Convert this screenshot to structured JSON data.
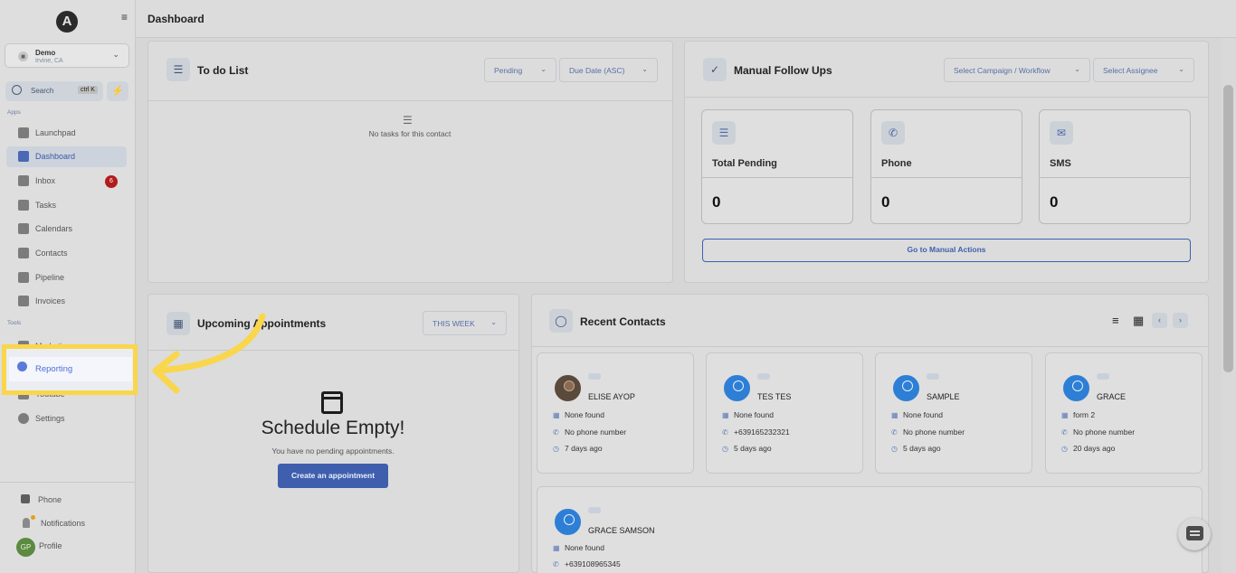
{
  "sidebar": {
    "logo": "A",
    "location": {
      "name": "Demo",
      "sub": "Irvine, CA"
    },
    "search": {
      "label": "Search",
      "shortcut": "ctrl K"
    },
    "sections": {
      "apps": "Apps",
      "tools": "Tools"
    },
    "items": [
      {
        "label": "Launchpad",
        "icon": "rocket-icon"
      },
      {
        "label": "Dashboard",
        "icon": "grid-icon",
        "active": true
      },
      {
        "label": "Inbox",
        "icon": "inbox-icon",
        "badge": "6"
      },
      {
        "label": "Tasks",
        "icon": "tasks-icon"
      },
      {
        "label": "Calendars",
        "icon": "calendar-icon"
      },
      {
        "label": "Contacts",
        "icon": "user-icon"
      },
      {
        "label": "Pipeline",
        "icon": "funnel-icon"
      },
      {
        "label": "Invoices",
        "icon": "invoice-icon"
      }
    ],
    "tools": [
      {
        "label": "Marketing",
        "icon": "megaphone-icon"
      },
      {
        "label": "Reporting",
        "icon": "pie-chart-icon",
        "highlighted": true
      },
      {
        "label": "Youtube",
        "icon": "youtube-icon"
      },
      {
        "label": "Settings",
        "icon": "gear-icon"
      }
    ],
    "footer": {
      "phone": "Phone",
      "notifications": "Notifications",
      "profile": "Profile",
      "initials": "GP"
    }
  },
  "header": {
    "title": "Dashboard"
  },
  "todo": {
    "title": "To do List",
    "filter_status": "Pending",
    "filter_sort": "Due Date (ASC)",
    "empty_text": "No tasks for this contact"
  },
  "followups": {
    "title": "Manual Follow Ups",
    "campaign_placeholder": "Select Campaign / Workflow",
    "assignee_placeholder": "Select Assignee",
    "stats": [
      {
        "label": "Total Pending",
        "value": "0",
        "icon": "checklist-icon"
      },
      {
        "label": "Phone",
        "value": "0",
        "icon": "phone-icon"
      },
      {
        "label": "SMS",
        "value": "0",
        "icon": "message-icon"
      }
    ],
    "action_label": "Go to Manual Actions"
  },
  "appointments": {
    "title": "Upcoming Appointments",
    "range": "THIS WEEK",
    "empty_title": "Schedule Empty!",
    "empty_sub": "You have no pending appointments.",
    "cta": "Create an appointment"
  },
  "contacts": {
    "title": "Recent Contacts",
    "items": [
      {
        "name": "ELISE AYOP",
        "company": "None found",
        "phone": "No phone number",
        "time": "7 days ago",
        "photo": true
      },
      {
        "name": "TES TES",
        "company": "None found",
        "phone": "+639165232321",
        "time": "5 days ago"
      },
      {
        "name": "SAMPLE",
        "company": "None found",
        "phone": "No phone number",
        "time": "5 days ago"
      },
      {
        "name": "GRACE",
        "company": "form 2",
        "phone": "No phone number",
        "time": "20 days ago"
      },
      {
        "name": "GRACE SAMSON",
        "company": "None found",
        "phone": "+639108965345",
        "time": ""
      }
    ]
  },
  "colors": {
    "accent": "#3f5fae",
    "highlight": "#f9d64c",
    "badge": "#b21c1c"
  }
}
